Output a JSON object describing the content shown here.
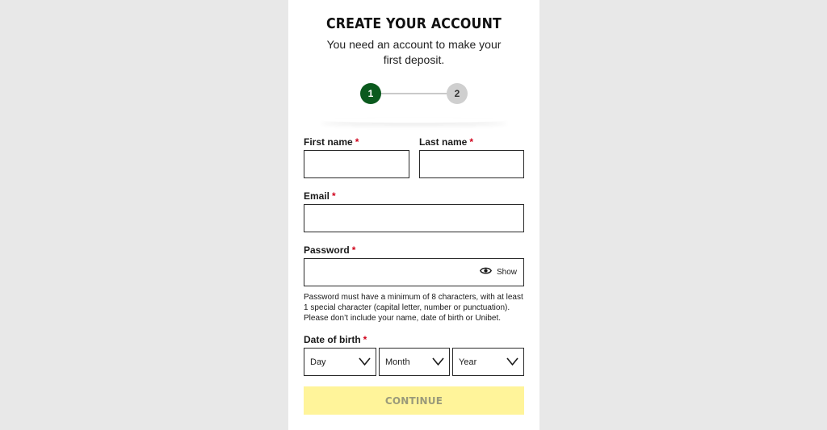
{
  "header": {
    "title": "CREATE YOUR ACCOUNT",
    "subtitle": "You need an account to make your first deposit."
  },
  "stepper": {
    "steps": [
      "1",
      "2"
    ],
    "current": 1,
    "active_color": "#0b5a1e",
    "inactive_color": "#cfcfcf"
  },
  "form": {
    "first_name": {
      "label": "First name",
      "required_mark": "*",
      "value": ""
    },
    "last_name": {
      "label": "Last name",
      "required_mark": "*",
      "value": ""
    },
    "email": {
      "label": "Email",
      "required_mark": "*",
      "value": ""
    },
    "password": {
      "label": "Password",
      "required_mark": "*",
      "value": "",
      "show_label": "Show",
      "hint": "Password must have a minimum of 8 characters, with at least 1 special character (capital letter, number or punctuation). Please don’t include your name, date of birth or Unibet."
    },
    "dob": {
      "label": "Date of birth",
      "required_mark": "*",
      "day": "Day",
      "month": "Month",
      "year": "Year"
    },
    "continue_label": "CONTINUE"
  },
  "colors": {
    "background": "#e8e8e8",
    "required": "#d0021b",
    "continue_bg": "#fff49a",
    "continue_text": "#9a9a7a"
  },
  "icons": {
    "password_toggle": "eye-icon",
    "select_arrow": "chevron-down-icon"
  }
}
